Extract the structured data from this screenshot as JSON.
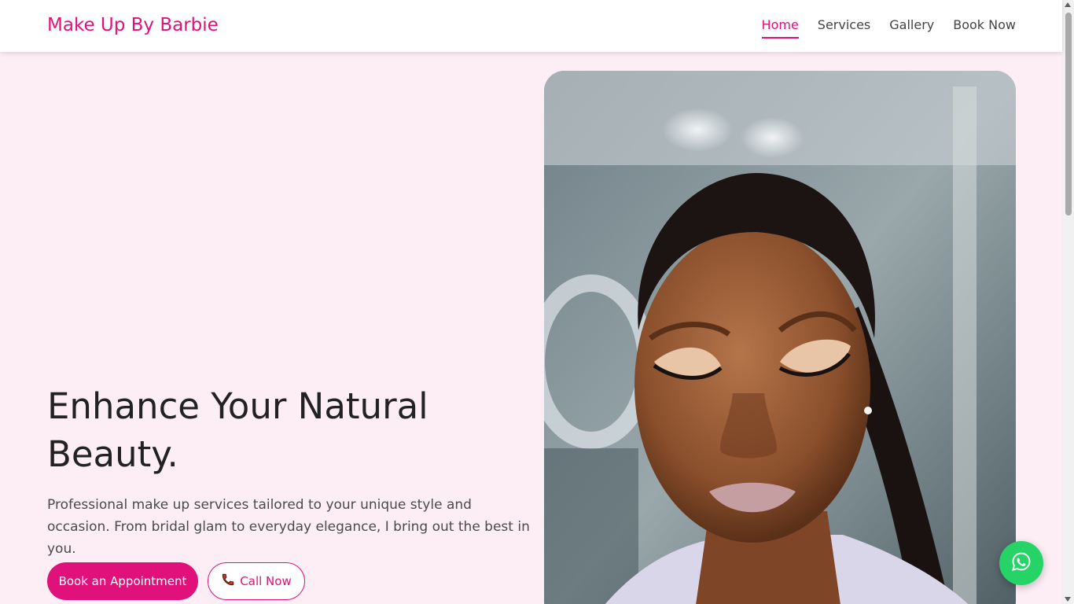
{
  "nav": {
    "brand": "Make Up By Barbie",
    "links": [
      {
        "label": "Home",
        "active": true
      },
      {
        "label": "Services",
        "active": false
      },
      {
        "label": "Gallery",
        "active": false
      },
      {
        "label": "Book Now",
        "active": false
      }
    ]
  },
  "hero": {
    "title": "Enhance Your Natural Beauty.",
    "description": "Professional make up services tailored to your unique style and occasion. From bridal glam to everyday elegance, I bring out the best in you.",
    "primary_button": "Book an Appointment",
    "secondary_button": "Call Now",
    "secondary_button_icon": "phone-icon",
    "image_icon": "portrait-photo"
  },
  "floating": {
    "icon": "whatsapp-icon"
  },
  "colors": {
    "accent": "#e0117a",
    "background": "#fdeef5",
    "whatsapp": "#25d366"
  }
}
